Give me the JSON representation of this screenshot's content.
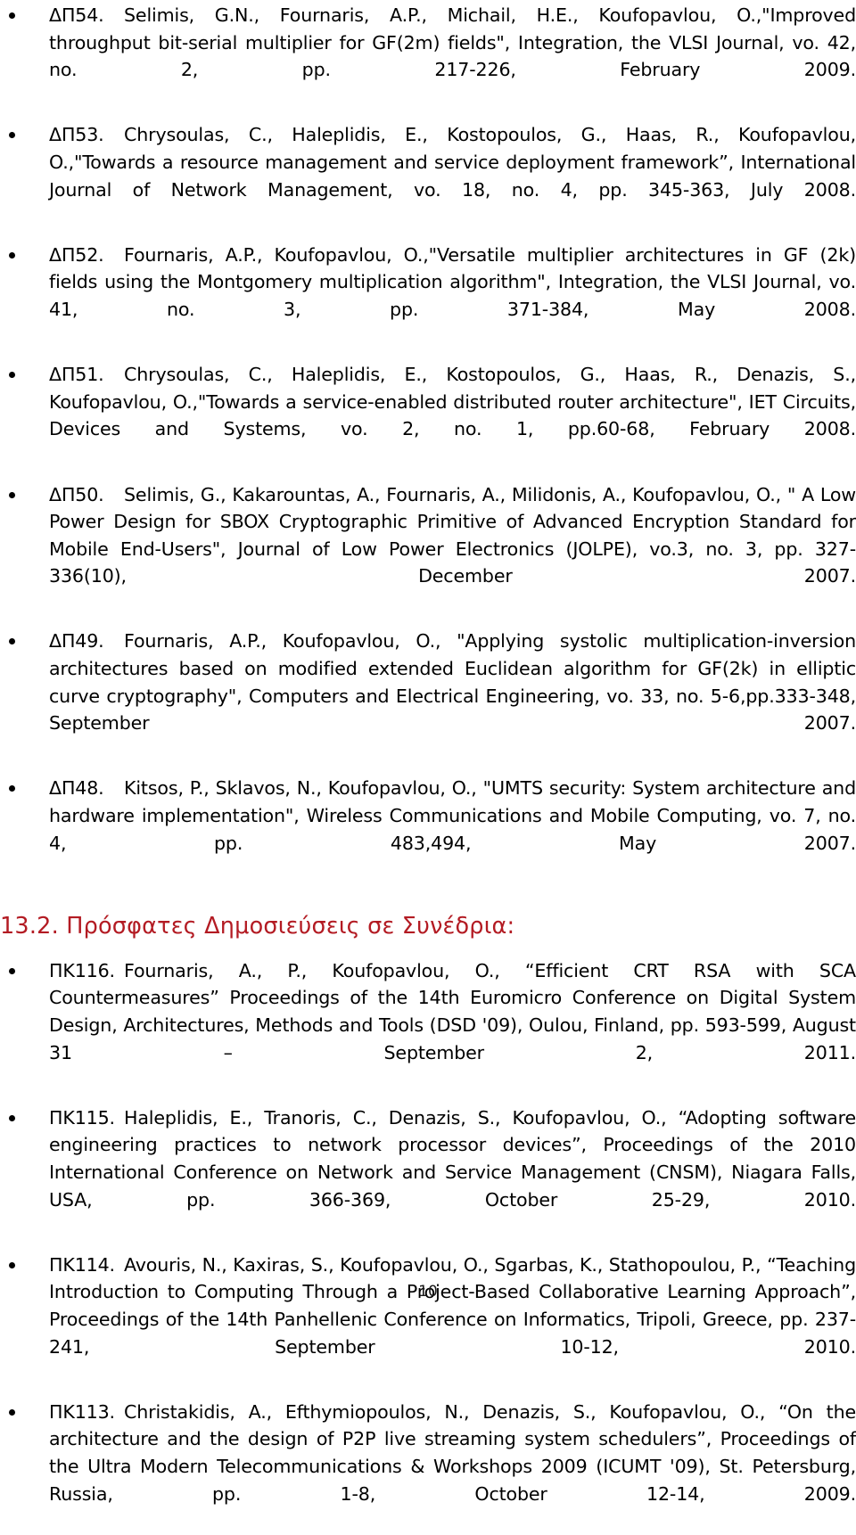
{
  "document": {
    "page_number": "10",
    "heading_color": "#B31B23",
    "body_color": "#000000",
    "background_color": "#FFFFFF"
  },
  "journal_publications": {
    "items": [
      {
        "label": "ΔΠ54.",
        "text": "Selimis, G.N., Fournaris, A.P., Michail, H.E., Koufopavlou, O.,\"Improved throughput bit-serial multiplier for GF(2m) fields\", Integration, the VLSI Journal, vo. 42, no. 2, pp. 217-226, February 2009."
      },
      {
        "label": "ΔΠ53.",
        "text": "Chrysoulas, C., Haleplidis, E., Kostopoulos, G., Haas, R., Koufopavlou, O.,\"Towards a resource management and service deployment framework”, International Journal of Network Management, vo. 18, no. 4, pp. 345-363, July 2008."
      },
      {
        "label": "ΔΠ52.",
        "text": "Fournaris, A.P., Koufopavlou, O.,\"Versatile multiplier architectures in GF (2k) fields using the Montgomery multiplication algorithm\", Integration, the VLSI Journal, vo. 41, no. 3, pp. 371-384, May 2008."
      },
      {
        "label": "ΔΠ51.",
        "text": "Chrysoulas, C., Haleplidis, E., Kostopoulos, G., Haas, R., Denazis, S., Koufopavlou, O.,\"Towards a service-enabled distributed router architecture\", IET Circuits, Devices and Systems, vo. 2, no. 1, pp.60-68, February 2008."
      },
      {
        "label": "ΔΠ50.",
        "text": "Selimis, G., Kakarountas, A., Fournaris, A., Milidonis, A., Koufopavlou, O., \" A Low Power Design for SBOX Cryptographic Primitive of Advanced Encryption Standard for Mobile End-Users\", Journal of Low Power Electronics (JOLPE), vo.3, no. 3, pp. 327-336(10), December 2007."
      },
      {
        "label": "ΔΠ49.",
        "text": "Fournaris, A.P., Koufopavlou, O., \"Applying systolic multiplication-inversion architectures based on modified extended Euclidean algorithm for GF(2k) in elliptic curve cryptography\", Computers and Electrical Engineering, vo. 33, no. 5-6,pp.333-348, September 2007."
      },
      {
        "label": "ΔΠ48.",
        "text": "Kitsos, P., Sklavos, N., Koufopavlou, O., \"UMTS security: System architecture and hardware implementation\", Wireless Communications and Mobile Computing, vo. 7, no. 4, pp. 483,494, May 2007."
      }
    ]
  },
  "conference_section": {
    "heading": "13.2. Πρόσφατες Δημοσιεύσεις σε Συνέδρια:",
    "items": [
      {
        "label": "ΠΚ116.",
        "text": "Fournaris, A., P., Koufopavlou, O., “Efficient CRT RSA with SCA Countermeasures” Proceedings of the 14th Euromicro Conference on Digital System Design, Architectures, Methods and Tools (DSD '09), Oulou, Finland, pp. 593-599, August 31 – September 2, 2011."
      },
      {
        "label": "ΠΚ115.",
        "text": "Haleplidis, E., Tranoris, C., Denazis, S., Koufopavlou, O., “Adopting software engineering practices to network processor devices”, Proceedings of the 2010 International Conference on Network and Service Management (CNSM), Niagara Falls, USA, pp. 366-369, October 25-29, 2010."
      },
      {
        "label": "ΠΚ114.",
        "text": "Avouris, N., Kaxiras, S., Koufopavlou, O., Sgarbas, K., Stathopoulou, P., “Teaching Introduction to Computing Through a Project-Based Collaborative Learning Approach”, Proceedings of the 14th Panhellenic Conference on Informatics, Tripoli, Greece, pp. 237-241, September 10-12, 2010."
      },
      {
        "label": "ΠΚ113.",
        "text": "Christakidis, A., Efthymiopoulos, N., Denazis, S., Koufopavlou, O., “On the architecture and the design of P2P live streaming system schedulers”, Proceedings of the Ultra Modern Telecommunications & Workshops 2009 (ICUMT '09), St. Petersburg, Russia, pp. 1-8, October 12-14, 2009."
      }
    ]
  }
}
